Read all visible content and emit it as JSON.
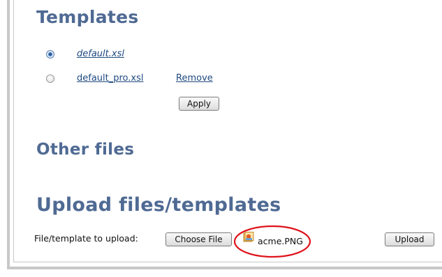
{
  "sections": {
    "templates_title": "Templates",
    "other_files_title": "Other files",
    "upload_title": "Upload files/templates"
  },
  "templates": [
    {
      "name": "default.xsl",
      "selected": true
    },
    {
      "name": "default_pro.xsl",
      "selected": false,
      "action": "Remove"
    }
  ],
  "buttons": {
    "apply": "Apply",
    "choose_file": "Choose File",
    "upload": "Upload"
  },
  "upload": {
    "label": "File/template to upload:",
    "chosen_file": "acme.PNG",
    "chosen_file_icon": "image-file-icon"
  },
  "colors": {
    "heading": "#4f6a93",
    "link": "#1f4a80",
    "highlight_circle": "#e0121b"
  }
}
